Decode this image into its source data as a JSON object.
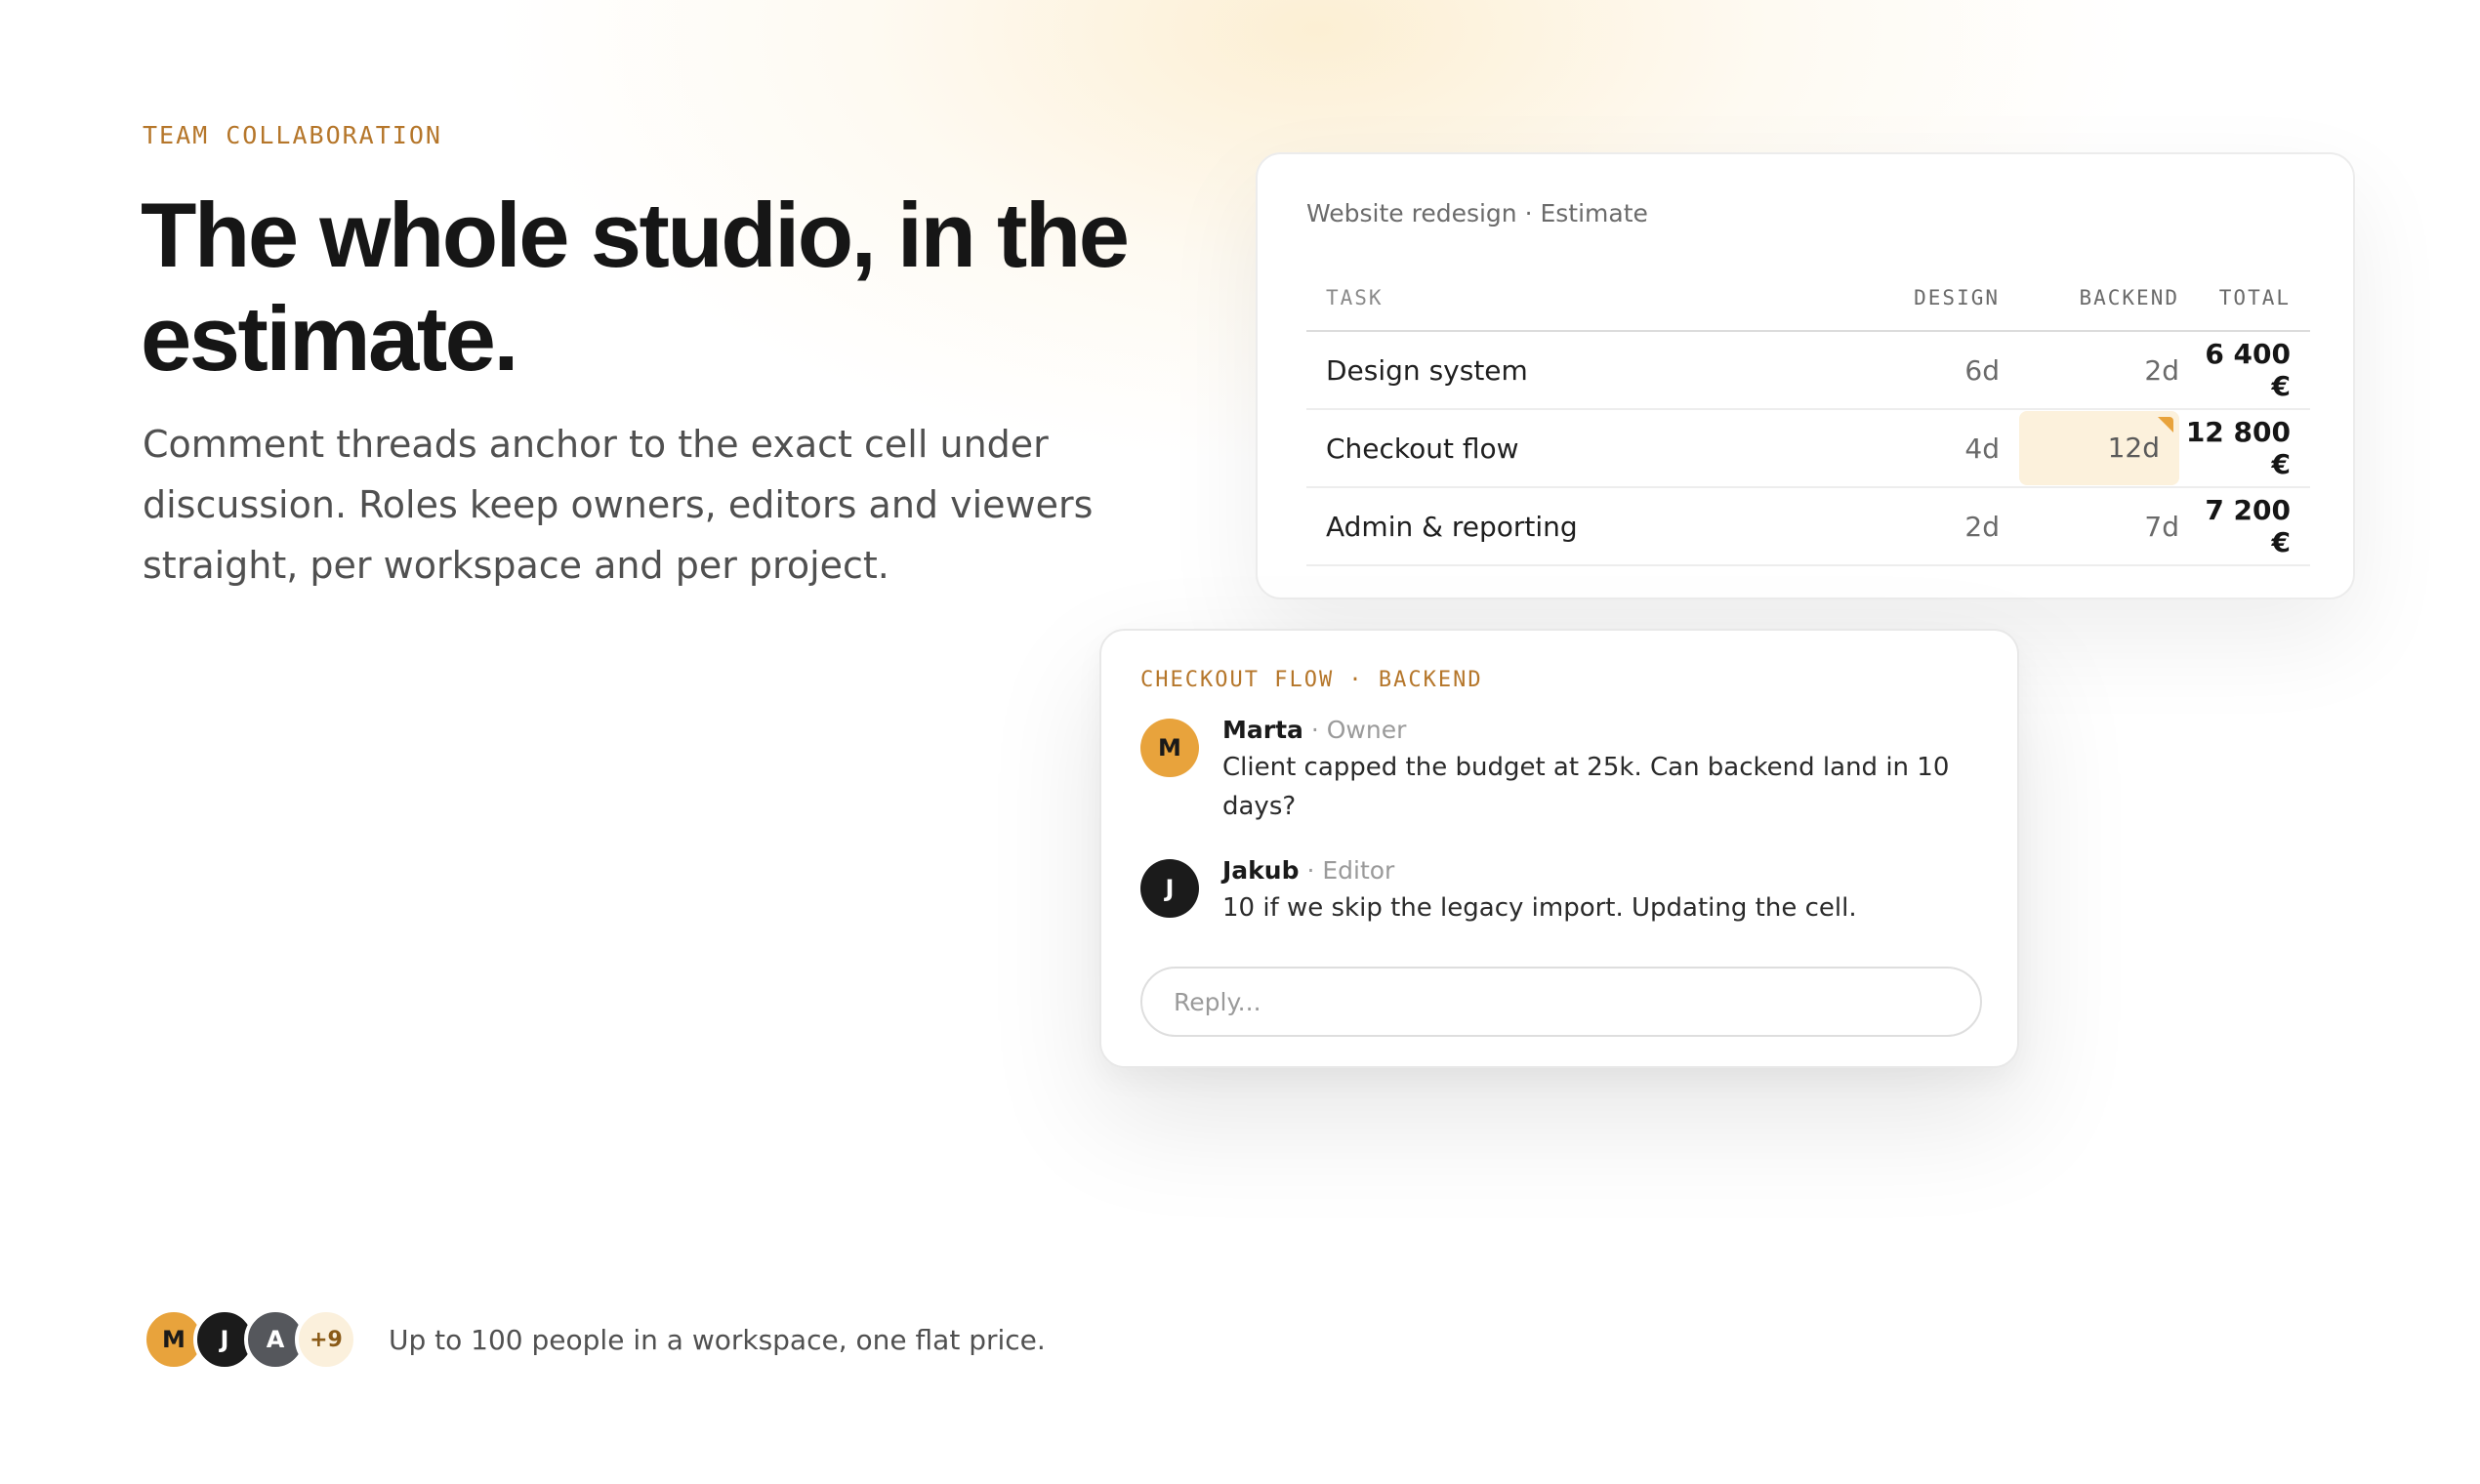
{
  "hero": {
    "eyebrow": "TEAM COLLABORATION",
    "headline": "The whole studio, in the estimate.",
    "lede": "Comment threads anchor to the exact cell under discussion. Roles keep owners, editors and viewers straight, per workspace and per project."
  },
  "estimate": {
    "title": "Website redesign · Estimate",
    "columns": [
      "TASK",
      "DESIGN",
      "BACKEND",
      "TOTAL"
    ],
    "rows": [
      {
        "task": "Design system",
        "design": "6d",
        "backend": "2d",
        "total": "6 400 €"
      },
      {
        "task": "Checkout flow",
        "design": "4d",
        "backend": "12d",
        "total": "12 800 €",
        "commented_cell": "backend"
      },
      {
        "task": "Admin & reporting",
        "design": "2d",
        "backend": "7d",
        "total": "7 200 €"
      }
    ],
    "highlight_color": "#fcf1dc",
    "comment_marker_color": "#e8a33c"
  },
  "thread": {
    "label": "CHECKOUT FLOW · BACKEND",
    "comments": [
      {
        "initial": "M",
        "author": "Marta",
        "role": "· Owner",
        "text": "Client capped the budget at 25k. Can backend land in 10 days?",
        "avatar_color": "#e8a33c"
      },
      {
        "initial": "J",
        "author": "Jakub",
        "role": "· Editor",
        "text": "10 if we skip the legacy import. Updating the cell.",
        "avatar_color": "#1b1b1b"
      }
    ],
    "reply_placeholder": "Reply..."
  },
  "team": {
    "avatars": [
      {
        "initial": "M",
        "color": "#e8a33c"
      },
      {
        "initial": "J",
        "color": "#1b1b1b"
      },
      {
        "initial": "A",
        "color": "#55575c"
      }
    ],
    "more": "+9",
    "caption": "Up to 100 people in a workspace, one flat price."
  },
  "colors": {
    "accent": "#b5762a",
    "accent_light": "#e8a33c",
    "text": "#161616",
    "muted": "#505050"
  }
}
